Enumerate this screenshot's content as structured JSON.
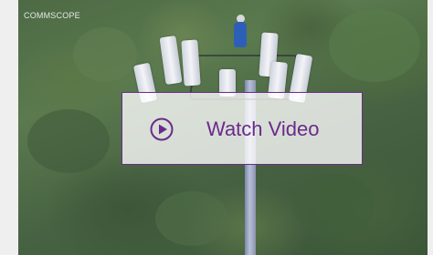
{
  "brand": {
    "logo_text": "COMMSCOPE"
  },
  "video": {
    "cta_label": "Watch Video",
    "play_icon": "play-circle-icon",
    "accent_color": "#6b2a8b"
  }
}
